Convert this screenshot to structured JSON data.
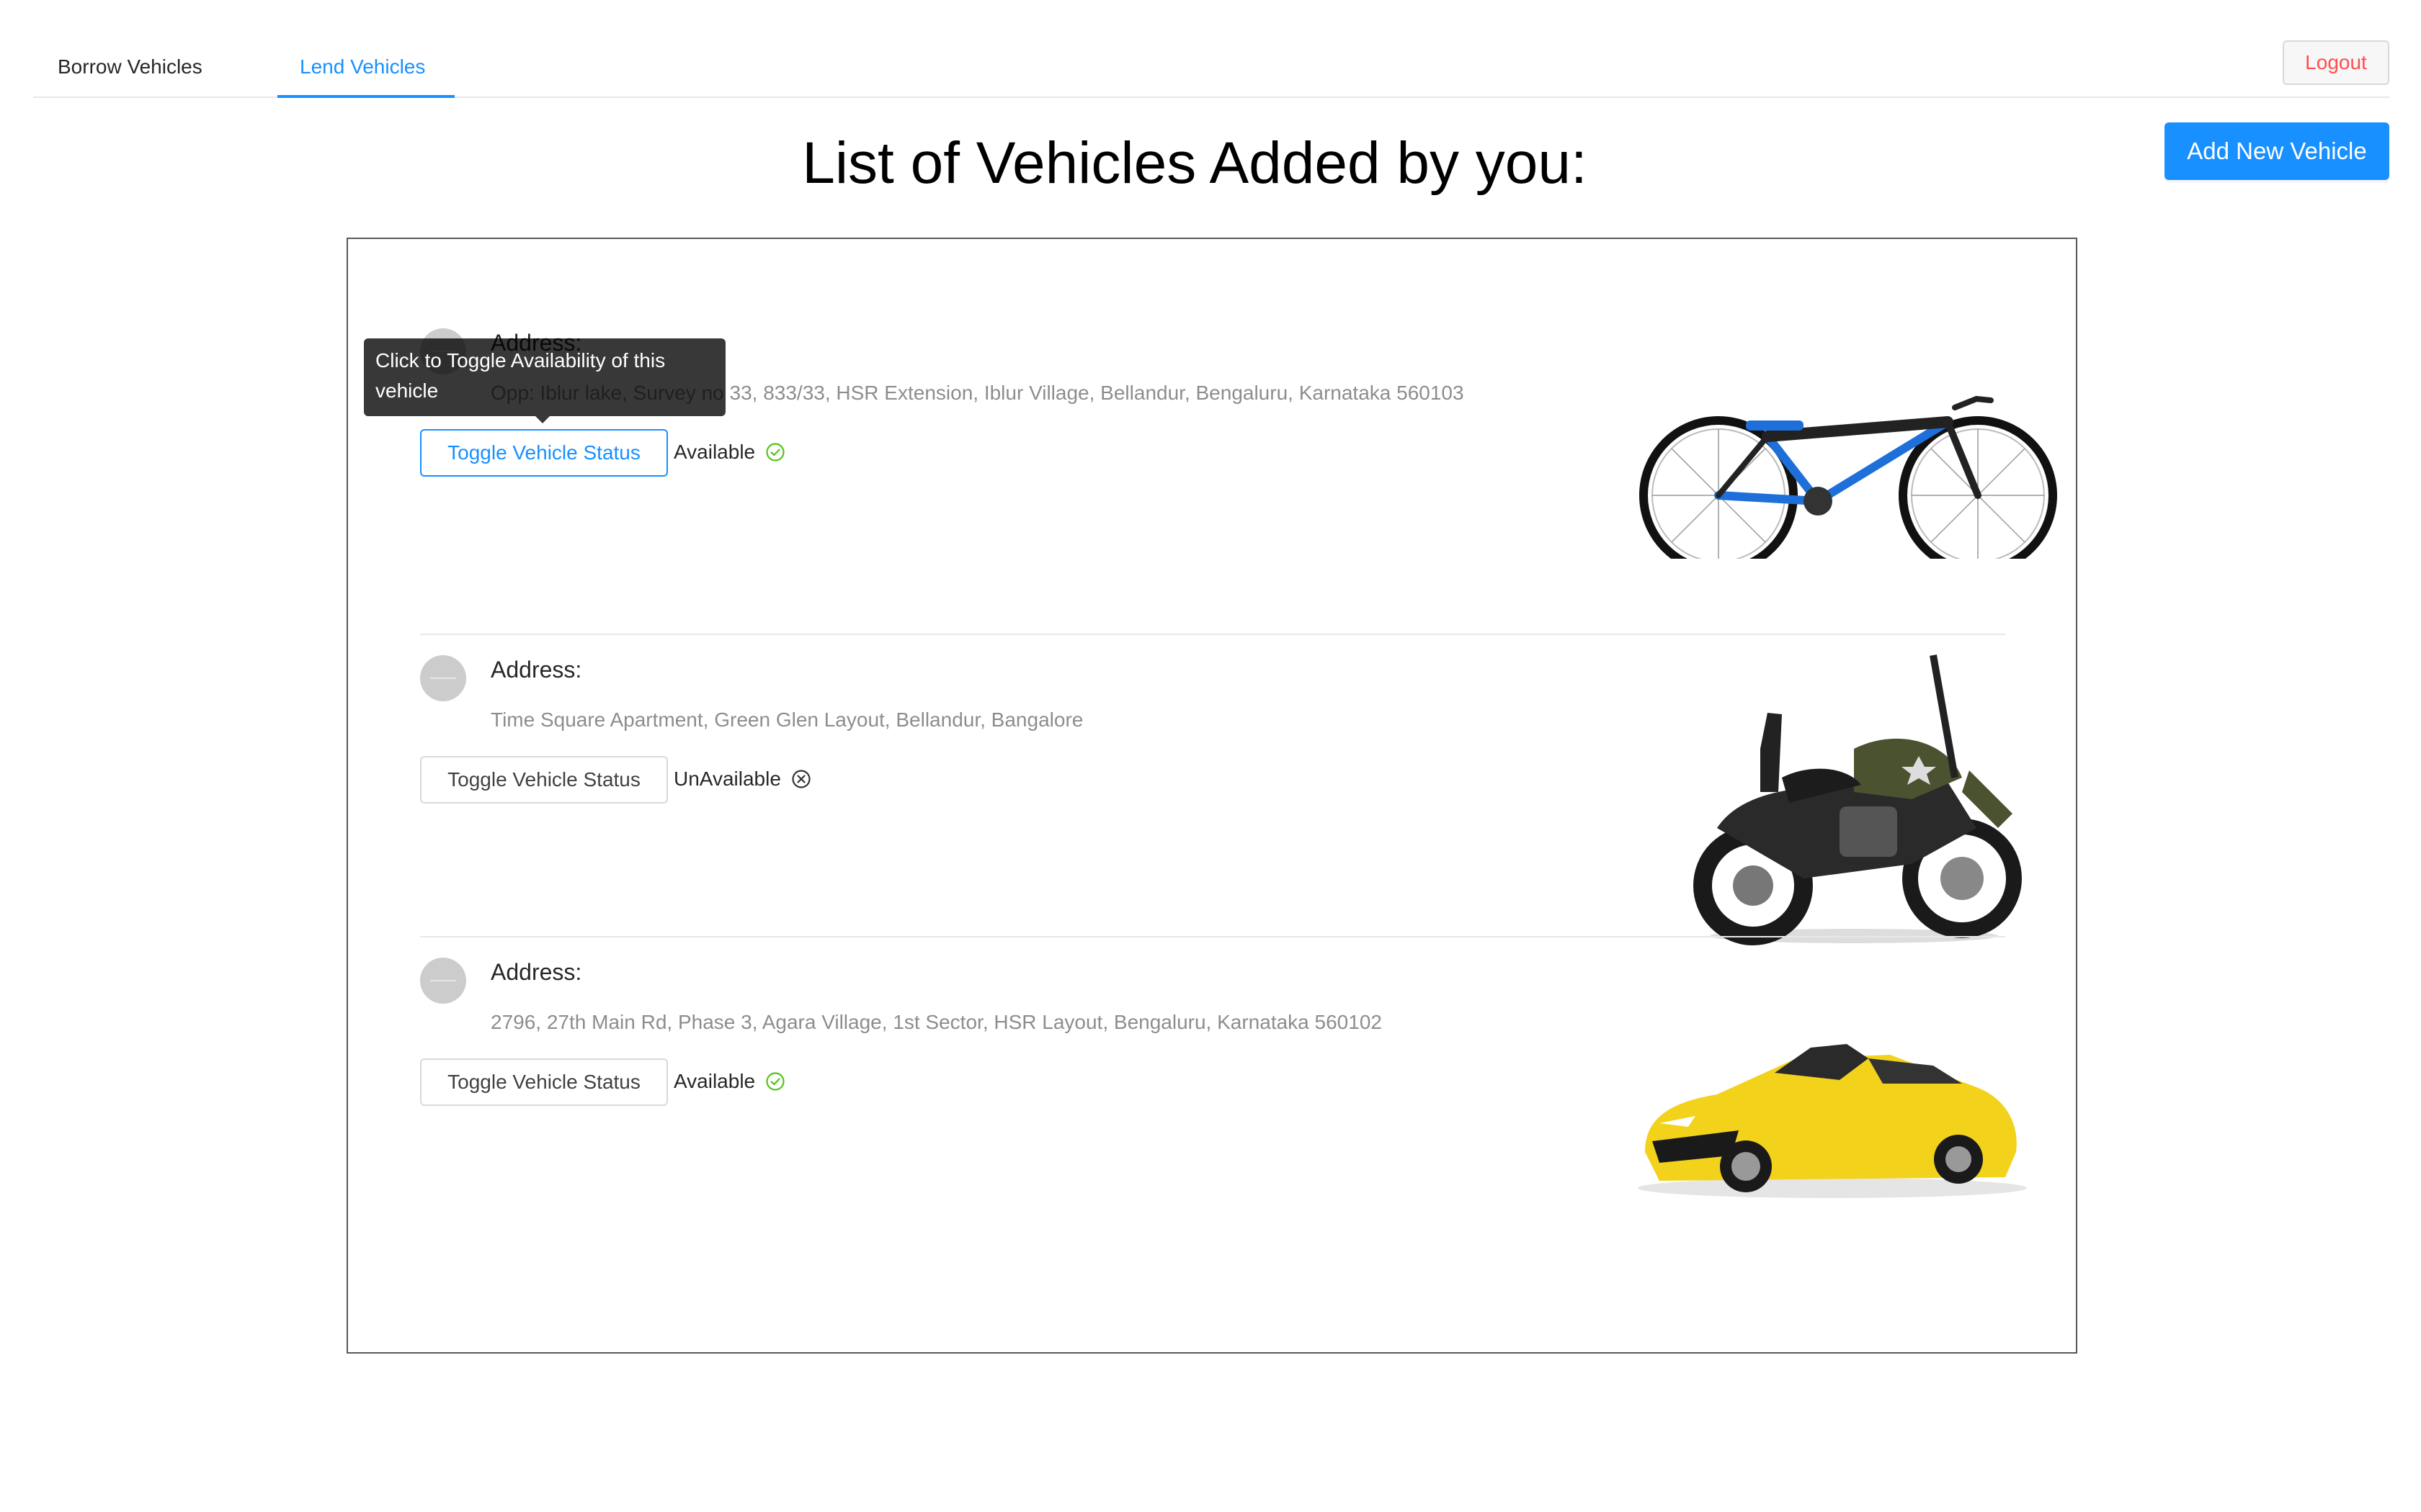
{
  "tabs": [
    {
      "label": "Borrow Vehicles",
      "active": false
    },
    {
      "label": "Lend Vehicles",
      "active": true
    }
  ],
  "header": {
    "logout_label": "Logout",
    "add_vehicle_label": "Add New Vehicle",
    "title": "List of Vehicles Added by you:"
  },
  "tooltip": {
    "text": "Click to Toggle Availability of this vehicle"
  },
  "vehicles": [
    {
      "address_title": "Address:",
      "address": "Opp: Iblur lake, Survey no 33, 833/33, HSR Extension, Iblur Village, Bellandur, Bengaluru, Karnataka 560103",
      "toggle_label": "Toggle Vehicle Status",
      "status": "Available",
      "status_icon": "check-circle-icon",
      "image": "bicycle-image"
    },
    {
      "address_title": "Address:",
      "address": "Time Square Apartment, Green Glen Layout, Bellandur, Bangalore",
      "toggle_label": "Toggle Vehicle Status",
      "status": "UnAvailable",
      "status_icon": "close-circle-icon",
      "image": "motorcycle-image"
    },
    {
      "address_title": "Address:",
      "address": "2796, 27th Main Rd, Phase 3, Agara Village, 1st Sector, HSR Layout, Bengaluru, Karnataka 560102",
      "toggle_label": "Toggle Vehicle Status",
      "status": "Available",
      "status_icon": "check-circle-icon",
      "image": "sports-car-image"
    }
  ],
  "colors": {
    "primary": "#1890ff",
    "danger": "#ff4d4f",
    "success": "#52c41a",
    "car_yellow": "#f2d21b",
    "moto_olive": "#4b5230"
  }
}
